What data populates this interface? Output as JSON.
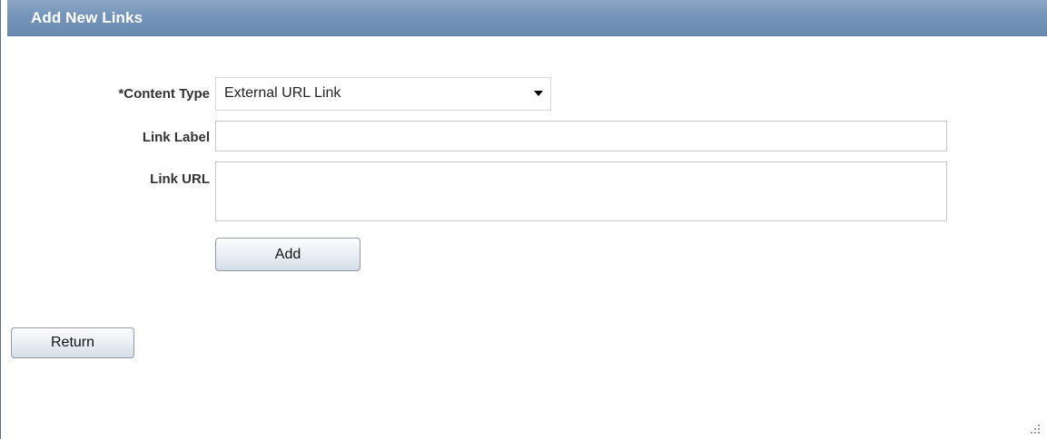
{
  "header": {
    "title": "Add New Links"
  },
  "form": {
    "content_type": {
      "label": "*Content Type",
      "selected": "External URL Link"
    },
    "link_label": {
      "label": "Link Label",
      "value": ""
    },
    "link_url": {
      "label": "Link URL",
      "value": ""
    },
    "add_label": "Add"
  },
  "footer": {
    "return_label": "Return"
  },
  "colors": {
    "header_background": "#7495b9",
    "header_text": "#ffffff",
    "label_text": "#333333"
  },
  "icons": {
    "dropdown": "chevron-down-icon",
    "resize": "resize-grip-icon"
  }
}
